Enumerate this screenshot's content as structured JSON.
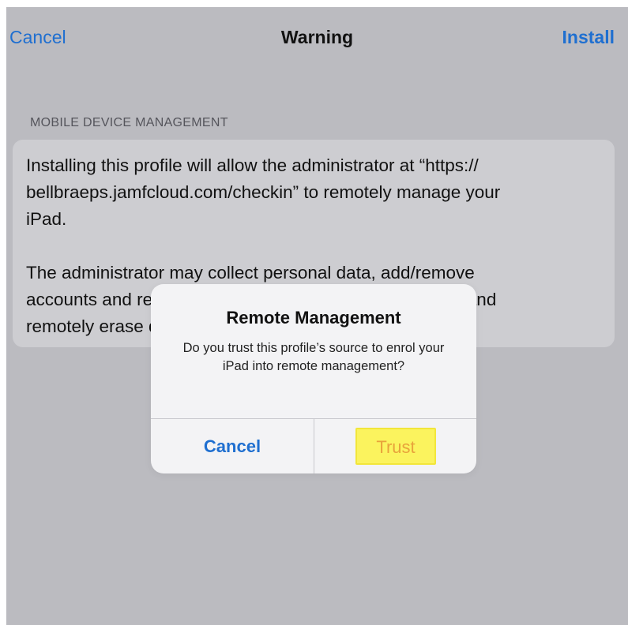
{
  "nav": {
    "cancel_label": "Cancel",
    "title": "Warning",
    "install_label": "Install"
  },
  "section": {
    "header": "MOBILE DEVICE MANAGEMENT",
    "body": "Installing this profile will allow the administrator at “https://\nbellbraeps.jamfcloud.com/checkin” to remotely manage your\niPad.\n\nThe administrator may collect personal data, add/remove\naccounts and restrictions, list, install and manage apps, and\nremotely erase data on your device."
  },
  "alert": {
    "title": "Remote Management",
    "message": "Do you trust this profile’s source to enrol your iPad into remote management?",
    "cancel_label": "Cancel",
    "trust_label": "Trust"
  },
  "colors": {
    "accent": "#1f6fd0",
    "background": "#bbbbc0",
    "highlight": "#fbf35e"
  }
}
